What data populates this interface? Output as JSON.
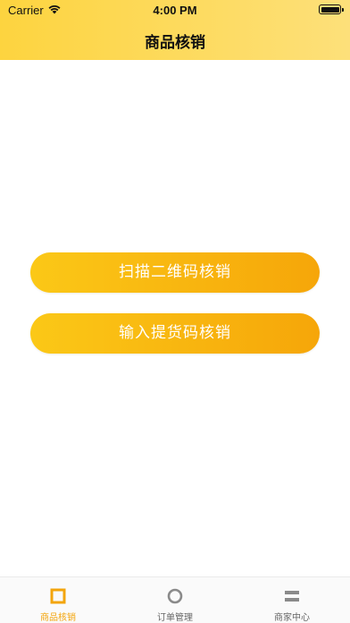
{
  "status_bar": {
    "carrier": "Carrier",
    "time": "4:00 PM",
    "icons": [
      "wifi-icon",
      "battery-icon"
    ]
  },
  "nav": {
    "title": "商品核销"
  },
  "actions": {
    "scan_label": "扫描二维码核销",
    "input_label": "输入提货码核销"
  },
  "tabbar": {
    "items": [
      {
        "label": "商品核销",
        "icon": "square-icon",
        "active": true
      },
      {
        "label": "订单管理",
        "icon": "circle-icon",
        "active": false
      },
      {
        "label": "商家中心",
        "icon": "equals-icon",
        "active": false
      }
    ]
  },
  "colors": {
    "header_start": "#fdd43f",
    "header_end": "#fde07a",
    "button_start": "#fbc817",
    "button_end": "#f6a609",
    "tab_active": "#f3a50d",
    "tab_inactive": "#8a8a8a"
  }
}
